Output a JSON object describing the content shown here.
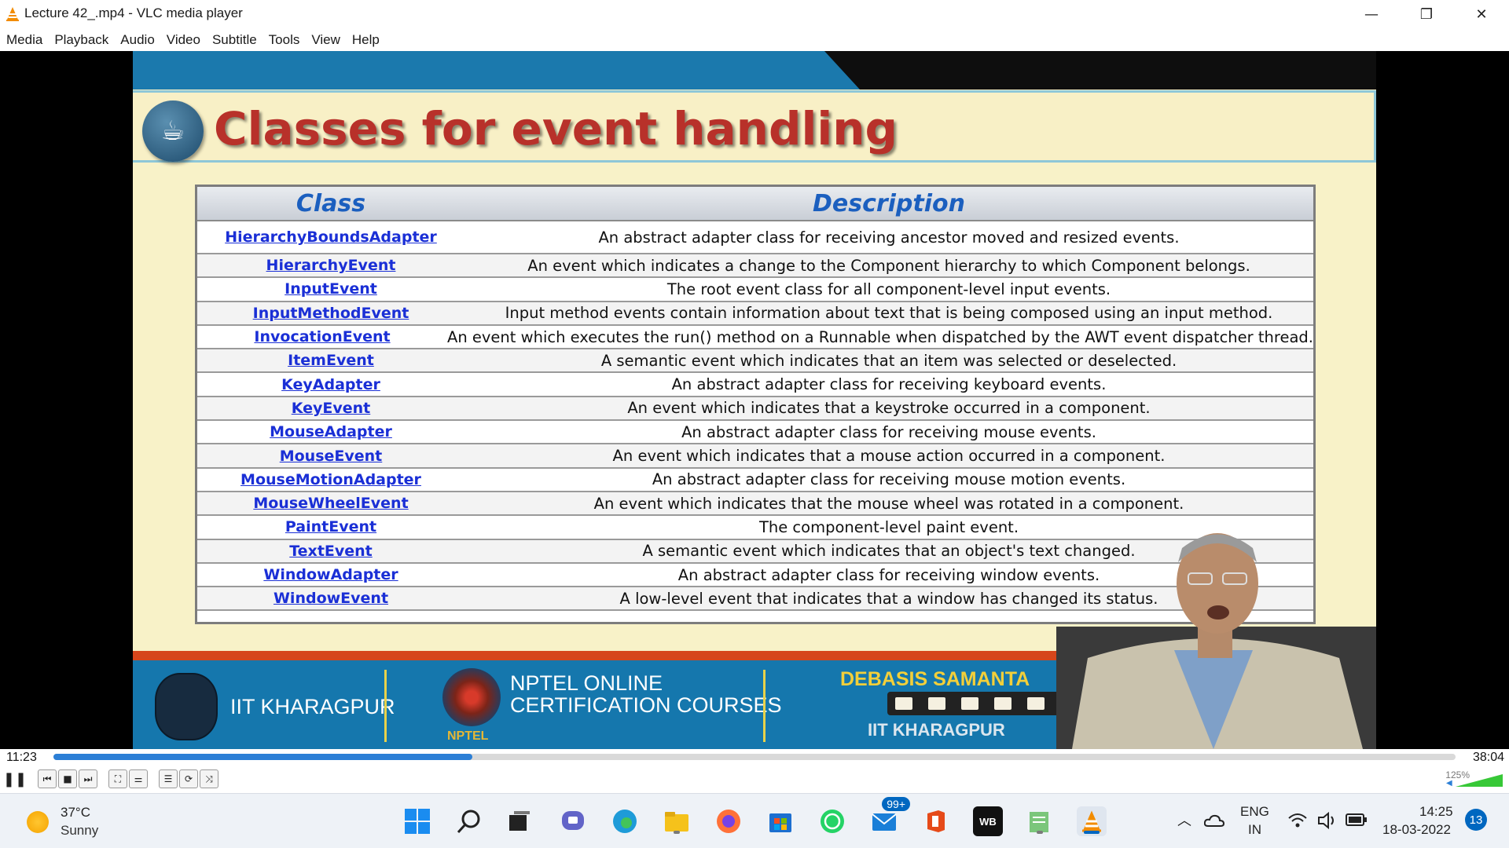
{
  "window": {
    "title": "Lecture 42_.mp4 - VLC media player",
    "minimize_symbol": "—",
    "restore_symbol": "❐",
    "close_symbol": "✕"
  },
  "menu": [
    "Media",
    "Playback",
    "Audio",
    "Video",
    "Subtitle",
    "Tools",
    "View",
    "Help"
  ],
  "slide": {
    "title": "Classes for event handling",
    "table": {
      "headers": [
        "Class",
        "Description"
      ],
      "rows": [
        {
          "cls": "HierarchyBoundsAdapter",
          "desc": "An abstract adapter class for receiving ancestor moved and resized events."
        },
        {
          "cls": "HierarchyEvent",
          "desc": "An event which indicates a change to the Component hierarchy to which Component belongs."
        },
        {
          "cls": "InputEvent",
          "desc": "The root event class for all component-level input events."
        },
        {
          "cls": "InputMethodEvent",
          "desc": "Input method events contain information about text that is being composed using an input method."
        },
        {
          "cls": "InvocationEvent",
          "desc": "An event which executes the run() method on a Runnable when dispatched by the AWT event dispatcher thread."
        },
        {
          "cls": "ItemEvent",
          "desc": "A semantic event which indicates that an item was selected or deselected."
        },
        {
          "cls": "KeyAdapter",
          "desc": "An abstract adapter class for receiving keyboard events."
        },
        {
          "cls": "KeyEvent",
          "desc": "An event which indicates that a keystroke occurred in a component."
        },
        {
          "cls": "MouseAdapter",
          "desc": "An abstract adapter class for receiving mouse events."
        },
        {
          "cls": "MouseEvent",
          "desc": "An event which indicates that a mouse action occurred in a component."
        },
        {
          "cls": "MouseMotionAdapter",
          "desc": "An abstract adapter class for receiving mouse motion events."
        },
        {
          "cls": "MouseWheelEvent",
          "desc": "An event which indicates that the mouse wheel was rotated in a component."
        },
        {
          "cls": "PaintEvent",
          "desc": "The component-level paint event."
        },
        {
          "cls": "TextEvent",
          "desc": "A semantic event which indicates that an object's text changed."
        },
        {
          "cls": "WindowAdapter",
          "desc": "An abstract adapter class for receiving window events."
        },
        {
          "cls": "WindowEvent",
          "desc": "A low-level event that indicates that a window has changed its status."
        }
      ]
    },
    "footer": {
      "institute": "IIT KHARAGPUR",
      "nptel_line1": "NPTEL ONLINE",
      "nptel_line2": "CERTIFICATION COURSES",
      "nptel_small": "NPTEL",
      "presenter_name": "DEBASIS SAMANTA",
      "presenter_institute": "IIT KHARAGPUR"
    }
  },
  "player": {
    "elapsed": "11:23",
    "total": "38:04",
    "progress_fraction": 0.299,
    "volume_label": "125%",
    "volume_fraction": 1.0,
    "accent_color": "#2c7fd6"
  },
  "taskbar": {
    "weather_temp": "37°C",
    "weather_condition": "Sunny",
    "mail_badge": "99+",
    "language_line1": "ENG",
    "language_line2": "IN",
    "clock_time": "14:25",
    "clock_date": "18-03-2022",
    "notification_count": "13",
    "wb_label": "WB"
  }
}
